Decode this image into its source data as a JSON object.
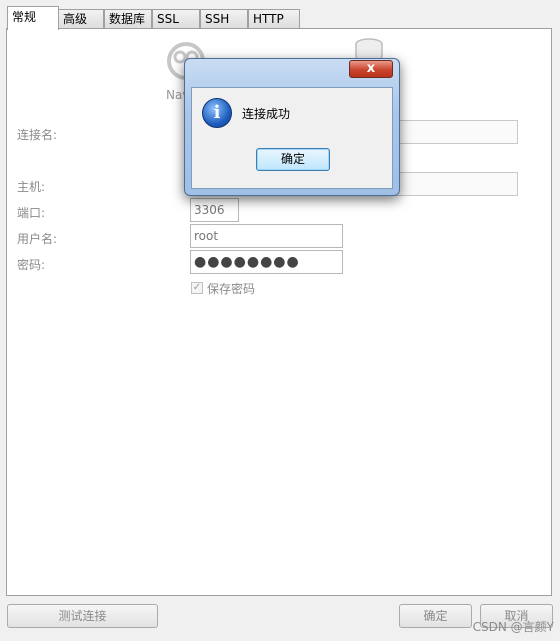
{
  "tabs": [
    {
      "label": "常规",
      "active": true
    },
    {
      "label": "高级",
      "active": false
    },
    {
      "label": "数据库",
      "active": false
    },
    {
      "label": "SSL",
      "active": false
    },
    {
      "label": "SSH",
      "active": false
    },
    {
      "label": "HTTP",
      "active": false
    }
  ],
  "header": {
    "app_logo_text": "Nav"
  },
  "form": {
    "connection_name_label": "连接名:",
    "connection_name_value": "",
    "host_label": "主机:",
    "host_value": "",
    "port_label": "端口:",
    "port_value": "3306",
    "username_label": "用户名:",
    "username_value": "root",
    "password_label": "密码:",
    "password_value": "●●●●●●●●",
    "save_password_label": "保存密码",
    "save_password_checked": true
  },
  "dialog": {
    "close_glyph": "x",
    "message": "连接成功",
    "ok_label": "确定",
    "info_glyph": "i"
  },
  "footer": {
    "test_connection_label": "测试连接",
    "ok_label": "确定",
    "cancel_label": "取消",
    "watermark": "CSDN @言颜Y"
  },
  "colors": {
    "dialog_frame": "#a9c6ea",
    "close_button": "#c9452e",
    "ok_button_border": "#3c7fb1",
    "info_icon": "#1f5fbf"
  }
}
